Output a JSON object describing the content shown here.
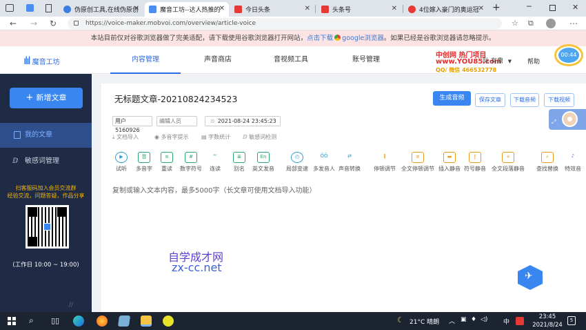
{
  "browser": {
    "tabs": [
      {
        "label": "伪原创工具,在线伪原创",
        "color": "#3e7de0"
      },
      {
        "label": "魔音工坊--达人热推的​",
        "color": "#4a8ef2"
      },
      {
        "label": "今日头条",
        "color": "#e53935"
      },
      {
        "label": "头条号",
        "color": "#e53935"
      },
      {
        "label": "4位嫁入豪门的奥运冠",
        "color": "#e53935"
      }
    ],
    "url": "https://voice-maker.mobvoi.com/overview/article-voice"
  },
  "notice": {
    "text_before": "本站目前仅对谷歌浏览器做了完美适配，请下载使用谷歌浏览器打开网站，",
    "link_text": "点击下载",
    "link_brand": "google浏览器",
    "text_after": "。如果已经是谷歌浏览器请忽略提示。"
  },
  "header": {
    "logo": "魔音工坊",
    "nav": [
      "内容管理",
      "声音商店",
      "音视频工具",
      "账号管理"
    ],
    "user": "际 有鼎",
    "help": "帮助",
    "timer": "00:44",
    "watermark_top": "中创网 热门项目",
    "watermark_url": "www.YOU85.com",
    "watermark_qq": "QQ/ 微信 466532778"
  },
  "sidebar": {
    "new_button": "新增文章",
    "items": [
      "我的文章",
      "敏感词管理"
    ],
    "promo_line1": "扫客服码加入会员交流群",
    "promo_line2": "经验交流，问题答疑，作品分享",
    "work_time": "(工作日 10:00 ~ 19:00)"
  },
  "editor": {
    "title": "无标题文章-20210824234523",
    "user_chip": "用户5160926",
    "editor_placeholder": "编辑人员",
    "datetime": "2021-08-24 23:45:23",
    "actions": [
      "生成音频",
      "保存文章",
      "下载音频",
      "下载视频"
    ],
    "sub_tools": [
      "文档导入",
      "多音字提示",
      "字数统计",
      "敏感词检测"
    ],
    "toolbar": [
      "试听",
      "多音字",
      "重读",
      "数字符号",
      "连读",
      "别名",
      "英文发音",
      "局部变速",
      "多发音人",
      "声音转换",
      "停顿调节",
      "全文停顿调节",
      "插入静音",
      "符号静音",
      "全文段落静音",
      "查找替换",
      "特效音"
    ],
    "placeholder": "复制或输入文本内容，最多5000字（长文章可使用文档导入功能）",
    "watermark_cn": "自学成才网",
    "watermark_url": "zx-cc.net"
  },
  "taskbar": {
    "weather": "21°C 晴朗",
    "ime": "中",
    "time": "23:45",
    "date": "2021/8/24",
    "badge": "5"
  }
}
